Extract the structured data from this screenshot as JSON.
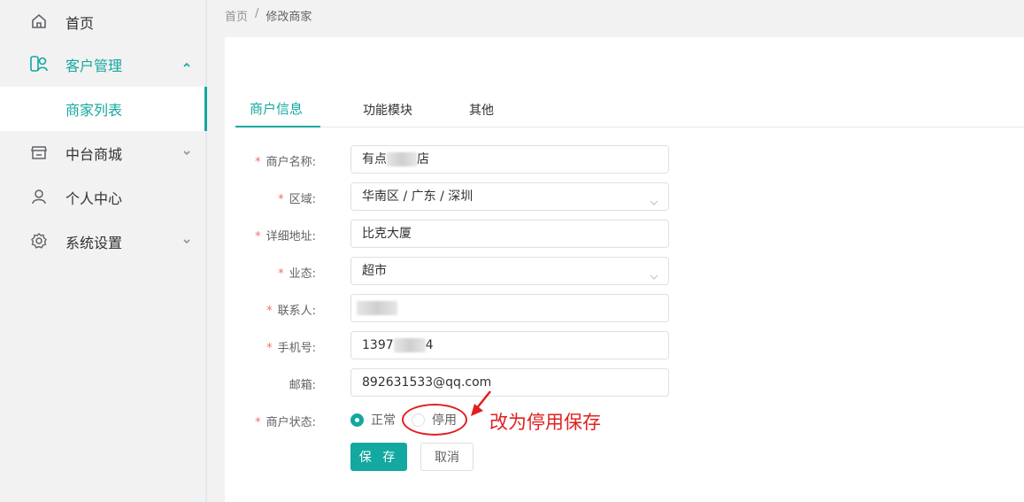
{
  "sidebar": {
    "items": [
      {
        "label": "首页",
        "icon": "home-icon"
      },
      {
        "label": "客户管理",
        "icon": "customer-icon",
        "expanded": true
      },
      {
        "label": "中台商城",
        "icon": "store-icon"
      },
      {
        "label": "个人中心",
        "icon": "user-icon"
      },
      {
        "label": "系统设置",
        "icon": "gear-icon"
      }
    ],
    "submenu": {
      "label": "商家列表"
    }
  },
  "breadcrumb": {
    "home": "首页",
    "sep": "/",
    "current": "修改商家"
  },
  "tabs": [
    {
      "label": "商户信息",
      "active": true
    },
    {
      "label": "功能模块"
    },
    {
      "label": "其他"
    }
  ],
  "form": {
    "name": {
      "label": "商户名称:",
      "prefix": "有点",
      "suffix": "店"
    },
    "region": {
      "label": "区域:",
      "value": "华南区 / 广东 / 深圳"
    },
    "address": {
      "label": "详细地址:",
      "value": "比克大厦"
    },
    "business": {
      "label": "业态:",
      "value": "超市"
    },
    "contact": {
      "label": "联系人:"
    },
    "phone": {
      "label": "手机号:",
      "prefix": "1397",
      "suffix": "4"
    },
    "email": {
      "label": "邮箱:",
      "value": "892631533@qq.com"
    },
    "status": {
      "label": "商户状态:",
      "options": [
        "正常",
        "停用"
      ],
      "selected": "正常"
    },
    "required_mark": "*"
  },
  "buttons": {
    "save": "保 存",
    "cancel": "取消"
  },
  "annotation": {
    "text": "改为停用保存",
    "color": "#e02020"
  },
  "colors": {
    "accent": "#13a8a0",
    "required": "#f56c6c"
  }
}
